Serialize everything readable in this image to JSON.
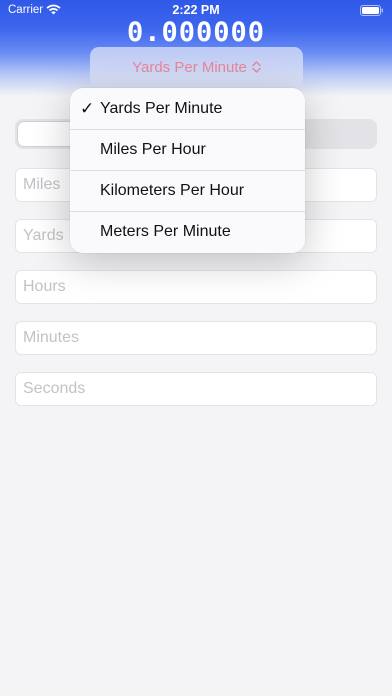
{
  "status_bar": {
    "carrier": "Carrier",
    "time": "2:22 PM"
  },
  "readout": "0.000000",
  "unit_selector": {
    "selected": "Yards Per Minute",
    "accent_color": "#e8879a"
  },
  "fields": [
    {
      "placeholder": "Miles"
    },
    {
      "placeholder": "Yards"
    },
    {
      "placeholder": "Hours"
    },
    {
      "placeholder": "Minutes"
    },
    {
      "placeholder": "Seconds"
    }
  ],
  "menu": {
    "items": [
      {
        "label": "Yards Per Minute",
        "checked": true
      },
      {
        "label": "Miles Per Hour",
        "checked": false
      },
      {
        "label": "Kilometers Per Hour",
        "checked": false
      },
      {
        "label": "Meters Per Minute",
        "checked": false
      }
    ],
    "check_mark": "✓"
  },
  "colors": {
    "header_blue": "#2f58e8",
    "background": "#f4f4f6"
  }
}
